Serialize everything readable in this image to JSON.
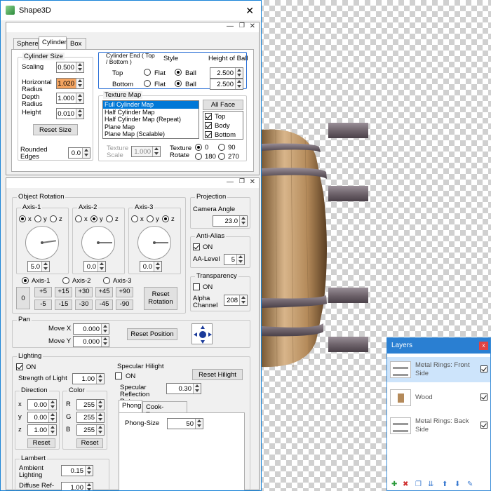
{
  "window": {
    "title": "Shape3D",
    "close": "✕"
  },
  "shape_tabs": [
    "Sphere",
    "Cylinder",
    "Box"
  ],
  "cylinder_size": {
    "title": "Cylinder Size",
    "scaling_label": "Scaling",
    "scaling": "0.500",
    "hradius_label": "Horizontal Radius",
    "hradius": "1.020",
    "dradius_label": "Depth Radius",
    "dradius": "1.000",
    "height_label": "Height",
    "height": "0.010",
    "reset": "Reset Size"
  },
  "rounded_edges": {
    "label": "Rounded Edges",
    "value": "0.0"
  },
  "cylinder_end": {
    "title": "Cylinder End ( Top / Bottom )",
    "style": "Style",
    "height_of_ball": "Height of Ball",
    "top": "Top",
    "bottom": "Bottom",
    "flat": "Flat",
    "ball": "Ball",
    "top_height": "2.500",
    "bottom_height": "2.500"
  },
  "texture_map": {
    "title": "Texture Map",
    "items": [
      "Full Cylinder Map",
      "Half Cylinder Map",
      "Half Cylinder Map (Repeat)",
      "Plane Map",
      "Plane Map (Scalable)"
    ],
    "all_face": "All Face",
    "faces": [
      "Top",
      "Body",
      "Bottom"
    ],
    "scale_label": "Texture Scale",
    "scale": "1.000",
    "rotate_label": "Texture Rotate",
    "rotate_options": [
      "0",
      "90",
      "180",
      "270"
    ]
  },
  "object_rotation": {
    "title": "Object Rotation",
    "axes": [
      {
        "name": "Axis-1",
        "value": "5.0"
      },
      {
        "name": "Axis-2",
        "value": "0.0"
      },
      {
        "name": "Axis-3",
        "value": "0.0"
      }
    ],
    "xyz": [
      "x",
      "y",
      "z"
    ],
    "zero": "0",
    "plus": [
      "+5",
      "+15",
      "+30",
      "+45",
      "+90"
    ],
    "minus": [
      "-5",
      "-15",
      "-30",
      "-45",
      "-90"
    ],
    "reset": "Reset Rotation"
  },
  "projection": {
    "title": "Projection",
    "camera_label": "Camera Angle",
    "camera": "23.0"
  },
  "antialias": {
    "title": "Anti-Alias",
    "on": "ON",
    "level_label": "AA-Level",
    "level": "5"
  },
  "transparency": {
    "title": "Transparency",
    "on": "ON",
    "alpha_label": "Alpha Channel",
    "alpha": "208"
  },
  "pan": {
    "title": "Pan",
    "movex_label": "Move X :",
    "movex": "0.000",
    "movey_label": "Move Y :",
    "movey": "0.000",
    "reset": "Reset Position"
  },
  "lighting": {
    "title": "Lighting",
    "on": "ON",
    "strength_label": "Strength of Light",
    "strength": "1.00",
    "direction": "Direction",
    "dx": "0.00",
    "dy": "0.00",
    "dz": "1.00",
    "color": "Color",
    "r": "255",
    "g": "255",
    "b": "255",
    "reset": "Reset",
    "x": "x",
    "y": "y",
    "z": "z",
    "rl": "R",
    "gl": "G",
    "bl": "B"
  },
  "specular": {
    "title": "Specular Hilight",
    "on": "ON",
    "reset": "Reset Hilight",
    "rate_label": "Specular Reflection Rate",
    "rate": "0.30",
    "tabs": [
      "Phong",
      "Cook-Torrance"
    ],
    "phong_label": "Phong-Size",
    "phong": "50"
  },
  "lambert": {
    "title": "Lambert",
    "ambient_label": "Ambient Lighting",
    "ambient": "0.15",
    "diffuse_label": "Diffuse Ref-",
    "diffuse": "1.00"
  },
  "layers": {
    "title": "Layers",
    "close": "x",
    "items": [
      "Metal Rings: Front Side",
      "Wood",
      "Metal Rings: Back Side"
    ]
  }
}
